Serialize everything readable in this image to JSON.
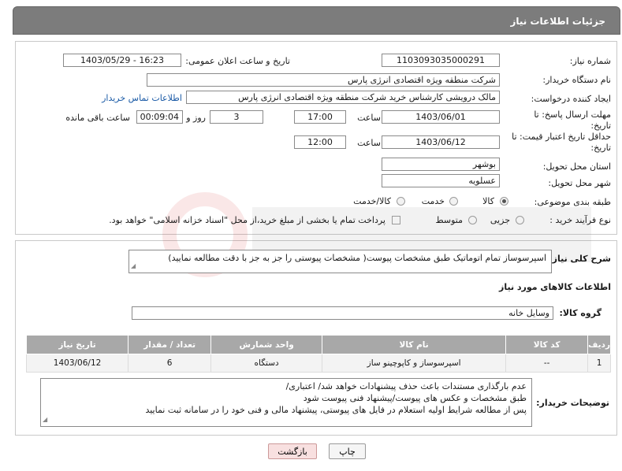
{
  "header": {
    "title": "جزئیات اطلاعات نیاز"
  },
  "form": {
    "need_number": {
      "label": "شماره نیاز:",
      "value": "1103093035000291"
    },
    "announce_datetime": {
      "label": "تاریخ و ساعت اعلان عمومی:",
      "value": "1403/05/29 - 16:23"
    },
    "buyer_org": {
      "label": "نام دستگاه خریدار:",
      "value": "شرکت منطقه ویژه اقتصادی انرژی پارس"
    },
    "requester": {
      "label": "ایجاد کننده درخواست:",
      "value": "مالک  درویشی کارشناس خرید شرکت منطقه ویژه اقتصادی انرژی پارس",
      "contact_link": "اطلاعات تماس خریدار"
    },
    "response_deadline": {
      "label_line1": "مهلت ارسال پاسخ: تا",
      "label_line2": "تاریخ:",
      "date": "1403/06/01",
      "time_label": "ساعت",
      "time": "17:00",
      "days": "3",
      "days_label": "روز و",
      "remaining": "00:09:04",
      "remaining_label": "ساعت باقی مانده"
    },
    "price_validity": {
      "label_line1": "حداقل تاریخ اعتبار قیمت: تا",
      "label_line2": "تاریخ:",
      "date": "1403/06/12",
      "time_label": "ساعت",
      "time": "12:00"
    },
    "province": {
      "label": "استان محل تحویل:",
      "value": "بوشهر"
    },
    "city": {
      "label": "شهر محل تحویل:",
      "value": "عسلویه"
    },
    "category": {
      "label": "طبقه بندی موضوعی:",
      "options": [
        "کالا",
        "خدمت",
        "کالا/خدمت"
      ],
      "selected": "کالا"
    },
    "purchase_type": {
      "label": "نوع فرآیند خرید :",
      "options": [
        "جزیی",
        "متوسط"
      ],
      "payment_note": "پرداخت تمام یا بخشی از مبلغ خرید،از محل \"اسناد خزانه اسلامی\" خواهد بود."
    }
  },
  "description": {
    "label": "شرح کلی نیاز:",
    "value": "اسپرسوساز تمام اتوماتیک طبق مشخصات پیوست( مشخصات پیوستی را جز به جز  با دقت مطالعه نمایید)"
  },
  "goods": {
    "section_title": "اطلاعات کالاهای مورد نیاز",
    "group_label": "گروه کالا:",
    "group_value": "وسایل خانه",
    "columns": [
      "ردیف",
      "کد کالا",
      "نام کالا",
      "واحد شمارش",
      "تعداد / مقدار",
      "تاریخ نیاز"
    ],
    "rows": [
      {
        "row": "1",
        "code": "--",
        "name": "اسپرسوساز و کاپوچینو ساز",
        "unit": "دستگاه",
        "qty": "6",
        "date": "1403/06/12"
      }
    ]
  },
  "buyer_notes": {
    "label": "توضیحات خریدار:",
    "lines": [
      "عدم بارگذاری مستندات باعث حذف پیشنهادات خواهد شد/ اعتباری/",
      "طبق مشخصات و عکس های پیوست/پیشنهاد فنی پیوست شود",
      "پس از مطالعه شرایط اولیه استعلام در فایل های پیوستی، پیشنهاد مالی و فنی خود را در سامانه ثبت نمایید"
    ]
  },
  "buttons": {
    "print": "چاپ",
    "back": "بازگشت"
  },
  "colors": {
    "header_bg": "#7c7c7c",
    "table_header_bg": "#a8a8a8",
    "back_button_bg": "#f8e0e0",
    "link": "#1a5aa6"
  }
}
